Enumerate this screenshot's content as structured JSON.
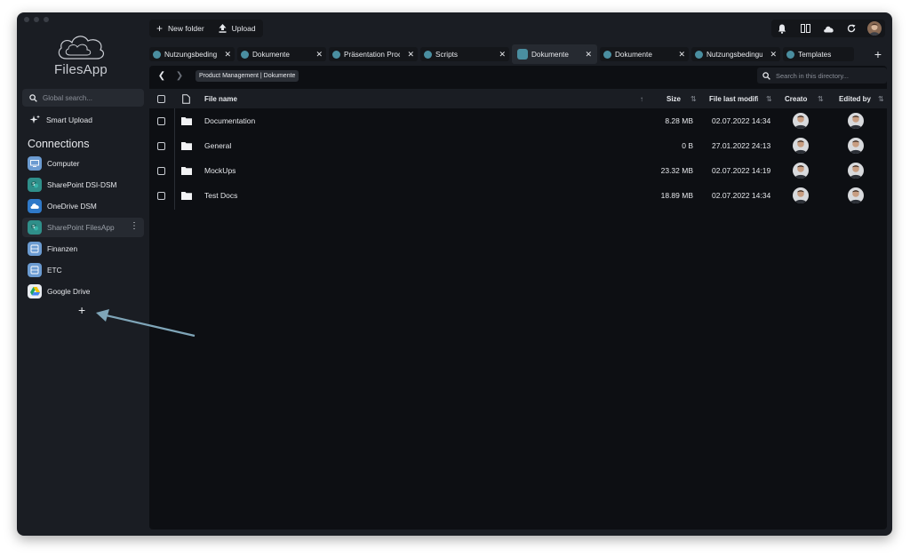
{
  "app": {
    "name": "FilesApp"
  },
  "sidebar": {
    "search_placeholder": "Global search...",
    "smart_upload": "Smart Upload",
    "connections_title": "Connections",
    "connections": [
      {
        "label": "Computer",
        "icon": "computer-icon",
        "color": "#6b9bd1"
      },
      {
        "label": "SharePoint DSI-DSM",
        "icon": "sharepoint-icon",
        "color": "#2f8f8a"
      },
      {
        "label": "OneDrive DSM",
        "icon": "onedrive-icon",
        "color": "#2f79c8"
      },
      {
        "label": "SharePoint FilesApp",
        "icon": "sharepoint-icon",
        "color": "#2f8f8a"
      },
      {
        "label": "Finanzen",
        "icon": "drive-icon",
        "color": "#6b9bd1"
      },
      {
        "label": "ETC",
        "icon": "drive-icon",
        "color": "#6b9bd1"
      },
      {
        "label": "Google Drive",
        "icon": "google-drive-icon",
        "color": "#f2c200"
      }
    ],
    "add_connection": "+"
  },
  "toolbar": {
    "new_folder": "New folder",
    "upload": "Upload"
  },
  "tabs": [
    {
      "label": "Nutzungsbedingu",
      "active": false
    },
    {
      "label": "Dokumente",
      "active": false
    },
    {
      "label": "Präsentation Proc",
      "active": false
    },
    {
      "label": "Scripts",
      "active": false
    },
    {
      "label": "Dokumente",
      "active": true
    },
    {
      "label": "Dokumente",
      "active": false
    },
    {
      "label": "Nutzungsbedingu",
      "active": false
    },
    {
      "label": "Templates",
      "active": false
    }
  ],
  "breadcrumb": "Product Management | Dokumente",
  "dir_search_placeholder": "Search in this directory...",
  "table": {
    "columns": {
      "name": "File name",
      "size": "Size",
      "modified": "File last modifi",
      "created": "Creato",
      "edited": "Edited by"
    },
    "rows": [
      {
        "name": "Documentation",
        "size": "8.28 MB",
        "modified": "02.07.2022 14:34"
      },
      {
        "name": "General",
        "size": "0 B",
        "modified": "27.01.2022 24:13"
      },
      {
        "name": "MockUps",
        "size": "23.32 MB",
        "modified": "02.07.2022 14:19"
      },
      {
        "name": "Test Docs",
        "size": "18.89 MB",
        "modified": "02.07.2022 14:34"
      }
    ]
  },
  "colors": {
    "accent": "#7fa5b8",
    "window_bg": "#1a1d23",
    "panel_bg": "#0d0f13"
  }
}
